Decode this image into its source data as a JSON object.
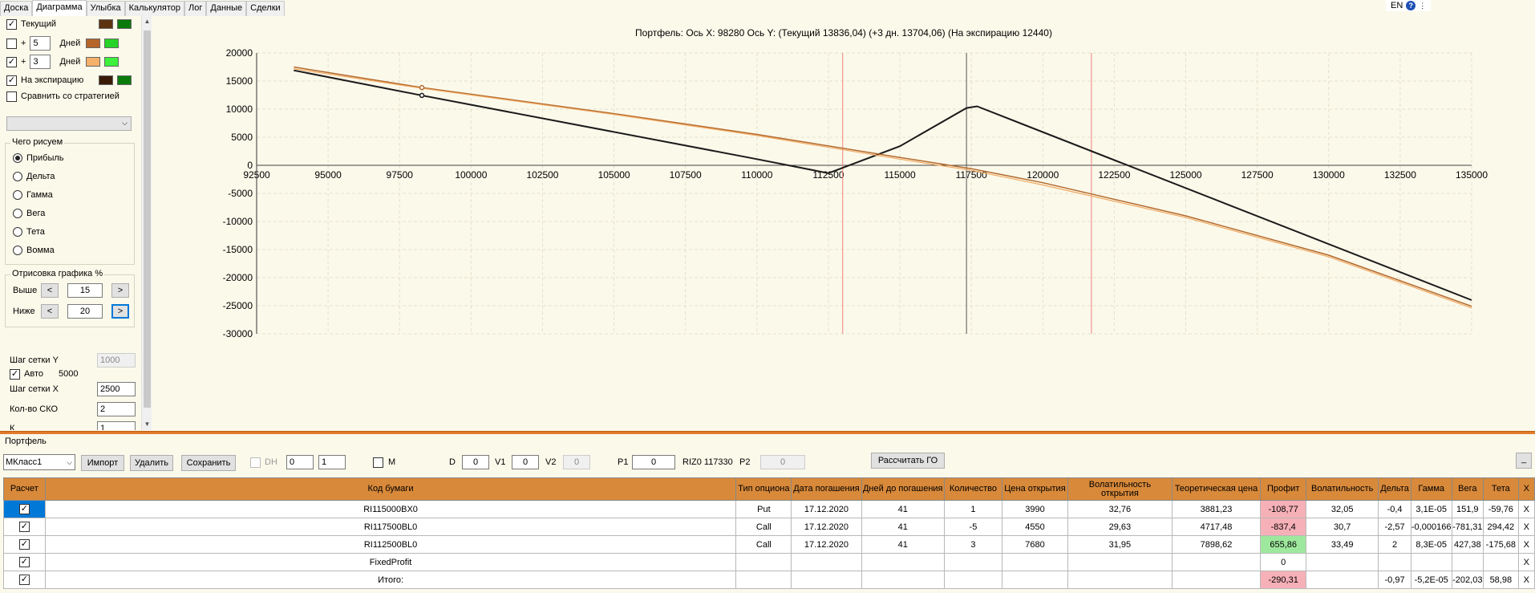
{
  "tabs": [
    "Доска",
    "Диаграмма",
    "Улыбка",
    "Калькулятор",
    "Лог",
    "Данные",
    "Сделки"
  ],
  "active_tab": 1,
  "lang": "EN",
  "help_label": "?",
  "left": {
    "current_label": "Текущий",
    "plus_sign": "+",
    "days_label": "Дней",
    "days1": "5",
    "days2": "3",
    "expiry_label": "На экспирацию",
    "compare_label": "Сравнить со стратегией",
    "draw_group_title": "Чего рисуем",
    "draw_options": [
      "Прибыль",
      "Дельта",
      "Гамма",
      "Вега",
      "Тета",
      "Вомма"
    ],
    "draw_selected": 0,
    "render_group_title": "Отрисовка графика %",
    "above_label": "Выше",
    "above_value": "15",
    "below_label": "Ниже",
    "below_value": "20",
    "prev_label": "<",
    "next_label": ">",
    "grid_y_label": "Шаг сетки Y",
    "grid_y_value": "1000",
    "auto_label": "Авто",
    "auto_value": "5000",
    "grid_x_label": "Шаг сетки X",
    "grid_x_value": "2500",
    "sko_label": "Кол-во СКО",
    "sko_value": "2",
    "cut_label": "К",
    "cut_value": "1",
    "colors": {
      "current_dark": "#5c3310",
      "current_light": "#0a7a0a",
      "d5_dark": "#b5652a",
      "d5_light": "#27d327",
      "d3_dark": "#f5b06a",
      "d3_light": "#3cf03c",
      "exp_dark": "#3a1b08",
      "exp_light": "#0a7a0a"
    }
  },
  "chart_data": {
    "type": "line",
    "title": "Портфель: Ось X: 98280 Ось Y:  (Текущий 13836,04)  (+3 дн. 13704,06)  (На экспирацию 12440)",
    "xlim": [
      92500,
      135000
    ],
    "ylim": [
      -30000,
      20000
    ],
    "xticks": [
      92500,
      95000,
      97500,
      100000,
      102500,
      105000,
      107500,
      110000,
      112500,
      115000,
      117500,
      120000,
      122500,
      125000,
      127500,
      130000,
      132500,
      135000
    ],
    "yticks": [
      20000,
      15000,
      10000,
      5000,
      0,
      -5000,
      -10000,
      -15000,
      -20000,
      -25000,
      -30000
    ],
    "vlines": [
      {
        "x": 113000,
        "color": "#f08080"
      },
      {
        "x": 117330,
        "color": "#555555"
      },
      {
        "x": 121700,
        "color": "#f08080"
      }
    ],
    "marker_x": 98280,
    "series": [
      {
        "color": "#1a1a1a",
        "width": 2,
        "x": [
          93800,
          98280,
          110000,
          112500,
          115000,
          117330,
          117700,
          135000
        ],
        "y": [
          16900,
          12440,
          1100,
          -1400,
          3400,
          10200,
          10500,
          -24000
        ]
      },
      {
        "color": "#b36a2e",
        "width": 1.5,
        "x": [
          93800,
          98280,
          105000,
          110000,
          115000,
          117500,
          120000,
          125000,
          130000,
          135000
        ],
        "y": [
          17500,
          13836,
          9200,
          5500,
          1400,
          -600,
          -3100,
          -9000,
          -16000,
          -25100
        ]
      },
      {
        "color": "#f0a860",
        "width": 1.2,
        "x": [
          93800,
          98280,
          105000,
          110000,
          115000,
          117500,
          120000,
          125000,
          130000,
          135000
        ],
        "y": [
          17200,
          13704,
          9050,
          5300,
          1100,
          -900,
          -3500,
          -9300,
          -16300,
          -25400
        ]
      }
    ]
  },
  "portfolio": {
    "title": "Портфель",
    "class_value": "МКласс1",
    "import_label": "Импорт",
    "delete_label": "Удалить",
    "save_label": "Сохранить",
    "dh_label": "DH",
    "dh_v1": "0",
    "dh_v2": "1",
    "m_label": "M",
    "d_label": "D",
    "d_value": "0",
    "v1_label": "V1",
    "v1_value": "0",
    "v2_label": "V2",
    "v2_value": "0",
    "p1_label": "P1",
    "p1_value": "0",
    "riz_label": "RIZ0 117330",
    "p2_label": "P2",
    "p2_value": "0",
    "calc_label": "Рассчитать ГО",
    "min_label": "_",
    "columns": [
      "Расчет",
      "Код бумаги",
      "Тип опциона",
      "Дата погашения",
      "Дней до погашения",
      "Количество",
      "Цена открытия",
      "Волатильность открытия",
      "Теоретическая цена",
      "Профит",
      "Волатильность",
      "Дельта",
      "Гамма",
      "Вега",
      "Тета",
      "X"
    ],
    "rows": [
      [
        "",
        "RI115000BX0",
        "Put",
        "17.12.2020",
        "41",
        "1",
        "3990",
        "32,76",
        "3881,23",
        "-108,77",
        "32,05",
        "-0,4",
        "3,1E-05",
        "151,9",
        "-59,76",
        "X"
      ],
      [
        "",
        "RI117500BL0",
        "Call",
        "17.12.2020",
        "41",
        "-5",
        "4550",
        "29,63",
        "4717,48",
        "-837,4",
        "30,7",
        "-2,57",
        "-0,000166",
        "-781,31",
        "294,42",
        "X"
      ],
      [
        "",
        "RI112500BL0",
        "Call",
        "17.12.2020",
        "41",
        "3",
        "7680",
        "31,95",
        "7898,62",
        "655,86",
        "33,49",
        "2",
        "8,3E-05",
        "427,38",
        "-175,68",
        "X"
      ],
      [
        "",
        "FixedProfit",
        "",
        "",
        "",
        "",
        "",
        "",
        "",
        "0",
        "",
        "",
        "",
        "",
        "",
        "X"
      ],
      [
        "",
        "Итого:",
        "",
        "",
        "",
        "",
        "",
        "",
        "",
        "-290,31",
        "",
        "-0,97",
        "-5,2E-05",
        "-202,03",
        "58,98",
        "X"
      ]
    ],
    "profit_class": [
      "neg",
      "neg",
      "pos",
      "",
      "neg"
    ]
  }
}
